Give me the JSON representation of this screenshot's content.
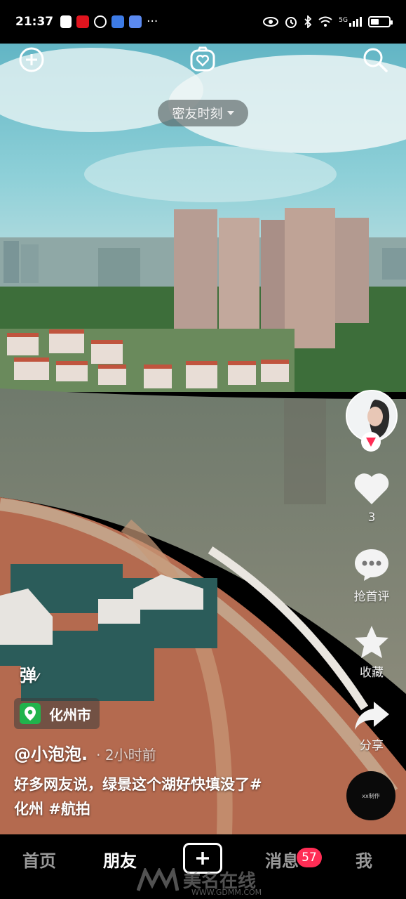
{
  "status_bar": {
    "time": "21:37",
    "network": "5G",
    "more": "···"
  },
  "top": {
    "mode_label": "密友时刻"
  },
  "rail": {
    "like_count": "3",
    "comment_label": "抢首评",
    "favorite_label": "收藏",
    "share_label": "分享"
  },
  "video": {
    "danmu_label": "弹",
    "location": "化州市",
    "author": "@小泡泡.",
    "time_ago": "· 2小时前",
    "caption_line1": "好多网友说，绿景这个湖好快填没了#",
    "caption_line2": "化州 #航拍",
    "music_disc_text": "xx制作"
  },
  "bottom_nav": {
    "home": "首页",
    "friends": "朋友",
    "messages": "消息",
    "me": "我",
    "messages_badge": "57"
  },
  "watermark": {
    "text": "美名在线",
    "url": "WWW.GDMM.COM"
  },
  "colors": {
    "badge": "#ff2d55",
    "location_icon": "#21b34c",
    "follow_icon": "#ff2d55"
  }
}
